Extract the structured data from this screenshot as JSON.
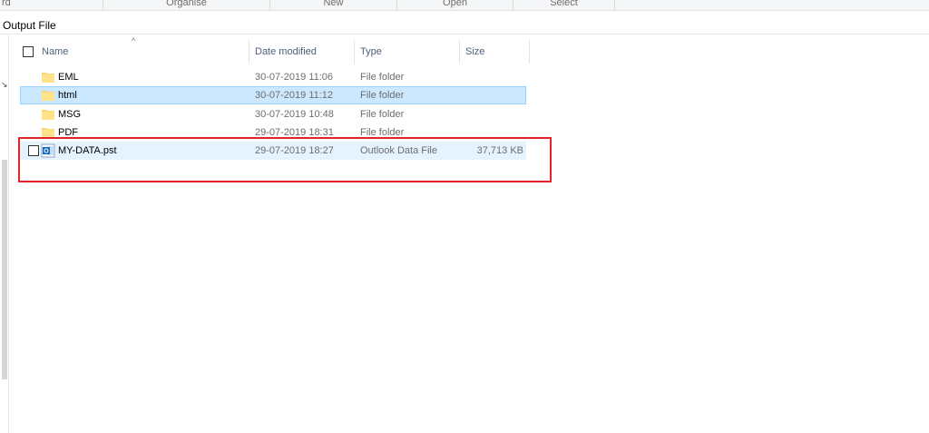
{
  "ribbon": {
    "groups": [
      "rd",
      "Organise",
      "New",
      "Open",
      "Select"
    ]
  },
  "path": {
    "current_folder": "Output File"
  },
  "columns": {
    "name": "Name",
    "date": "Date modified",
    "type": "Type",
    "size": "Size"
  },
  "files": [
    {
      "name": "EML",
      "date": "30-07-2019 11:06",
      "type": "File folder",
      "size": ""
    },
    {
      "name": "html",
      "date": "30-07-2019 11:12",
      "type": "File folder",
      "size": ""
    },
    {
      "name": "MSG",
      "date": "30-07-2019 10:48",
      "type": "File folder",
      "size": ""
    },
    {
      "name": "PDF",
      "date": "29-07-2019 18:31",
      "type": "File folder",
      "size": ""
    },
    {
      "name": "MY-DATA.pst",
      "date": "29-07-2019 18:27",
      "type": "Outlook Data File",
      "size": "37,713 KB"
    }
  ],
  "icons": {
    "folder": "folder-icon",
    "pst": "outlook-data-file-icon",
    "sort": "sort-ascending-icon"
  },
  "colors": {
    "selection": "#cce8ff",
    "hover": "#e5f3ff",
    "highlight_box": "#e0242a",
    "folder": "#f8d775"
  }
}
